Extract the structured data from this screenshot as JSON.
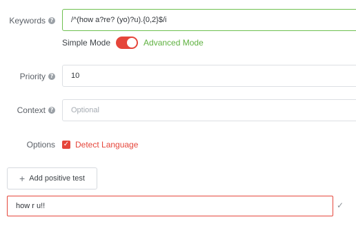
{
  "keywords": {
    "label": "Keywords",
    "help_icon": "question-circle-icon",
    "value": "/^(how a?re? (yo)?u).{0,2}$/i"
  },
  "mode": {
    "simple_label": "Simple Mode",
    "advanced_label": "Advanced Mode",
    "advanced_enabled": true
  },
  "priority": {
    "label": "Priority",
    "help_icon": "question-circle-icon",
    "value": "10"
  },
  "context": {
    "label": "Context",
    "help_icon": "question-circle-icon",
    "value": "",
    "placeholder": "Optional"
  },
  "options": {
    "label": "Options",
    "detect_language_label": "Detect Language",
    "detect_language_checked": true
  },
  "tests": {
    "add_label": "Add positive test",
    "add_icon": "plus-icon",
    "items": [
      {
        "value": "how r u!!",
        "status_icon": "check-icon"
      }
    ]
  },
  "colors": {
    "accent_red": "#e5453a",
    "accent_green": "#5eb13f",
    "active_border": "#6dbf4e"
  }
}
